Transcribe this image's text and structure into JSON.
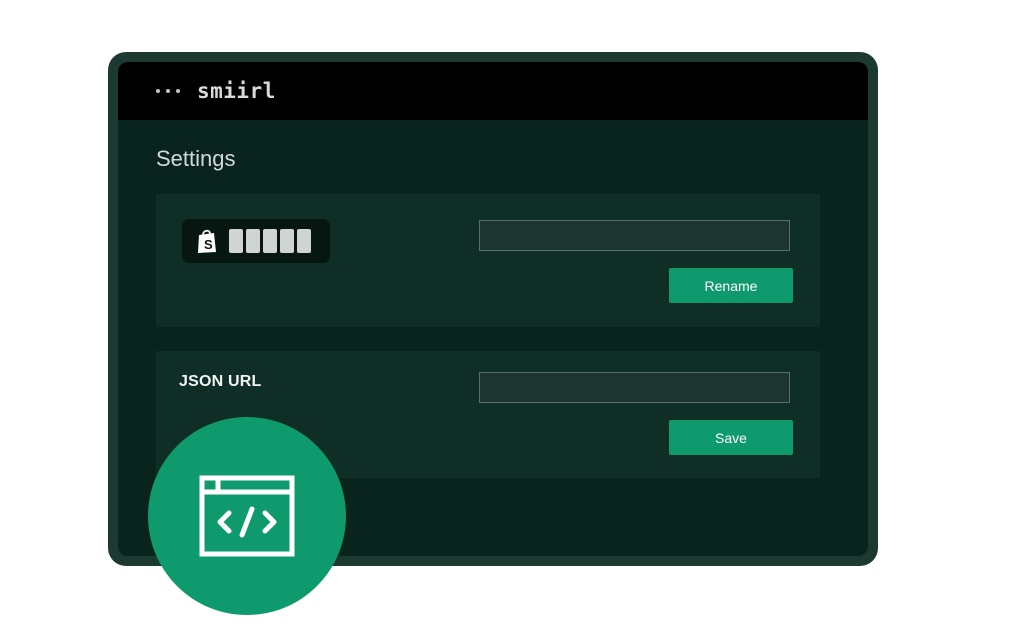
{
  "app": {
    "brand": "smiirl"
  },
  "page": {
    "title": "Settings"
  },
  "rename_card": {
    "field_value": "",
    "field_placeholder": "",
    "button_label": "Rename",
    "badge_icon": "shopify-bag-icon"
  },
  "json_card": {
    "label": "JSON URL",
    "field_value": "",
    "field_placeholder": "",
    "button_label": "Save"
  },
  "badge": {
    "icon": "embed-code-icon"
  },
  "colors": {
    "accent": "#0e9a6c",
    "frame": "#1c3a31",
    "window_bg": "#08241d",
    "card_bg": "#0f2e26",
    "topbar_bg": "#000000"
  }
}
